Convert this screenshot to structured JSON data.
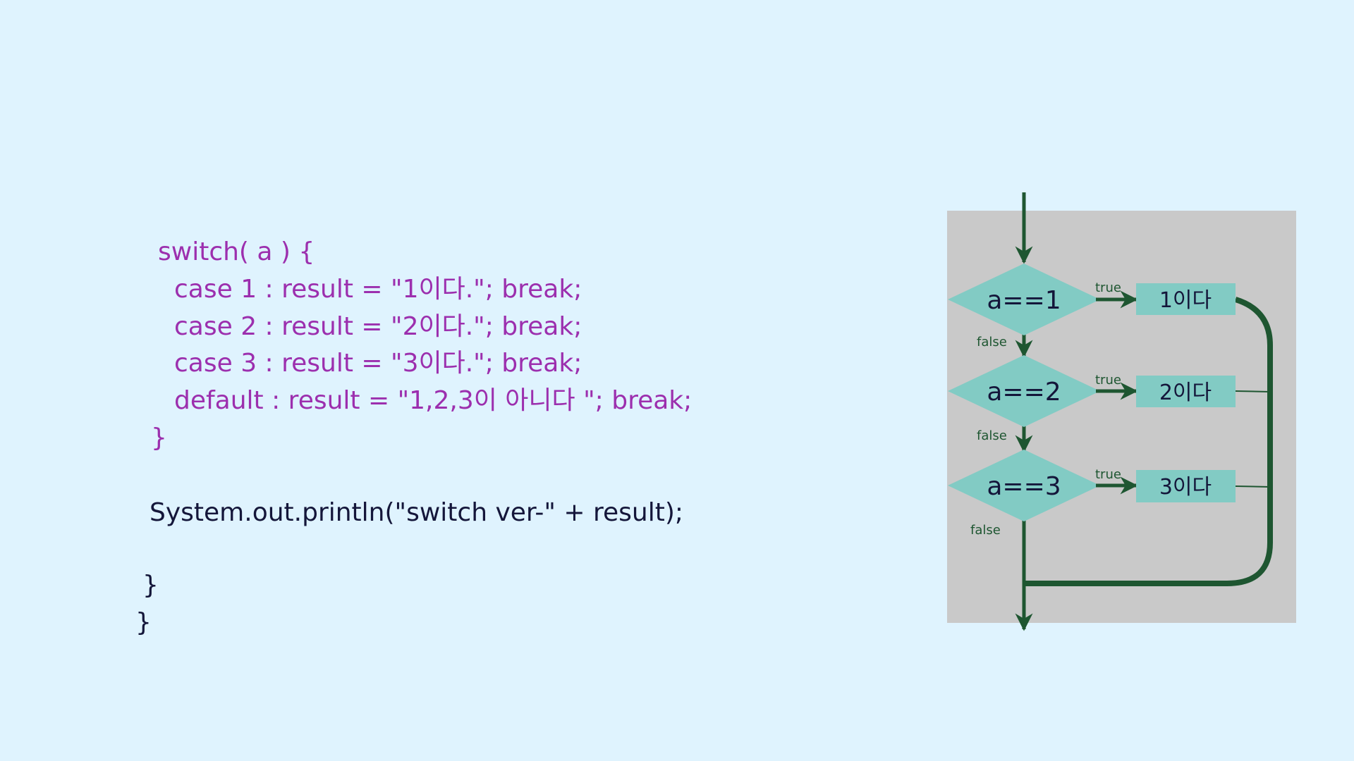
{
  "code": {
    "lines": [
      "switch( a ) {",
      "case 1 : result = \"1이다.\"; break;",
      "case 2 : result = \"2이다.\"; break;",
      "case 3 : result = \"3이다.\"; break;",
      "default : result = \"1,2,3이 아니다 \"; break;",
      "}",
      "System.out.println(\"switch ver-\" + result);",
      "}",
      "}"
    ]
  },
  "flowchart": {
    "conditions": [
      "a==1",
      "a==2",
      "a==3"
    ],
    "results": [
      "1이다",
      "2이다",
      "3이다"
    ],
    "true_label": "true",
    "false_label": "false"
  },
  "colors": {
    "background": "#dff3fe",
    "code_keyword": "#9c2fae",
    "code_text": "#14163a",
    "diagram_bg": "#c9c9c9",
    "node_fill": "#82cbc4",
    "arrow": "#1e5631"
  }
}
